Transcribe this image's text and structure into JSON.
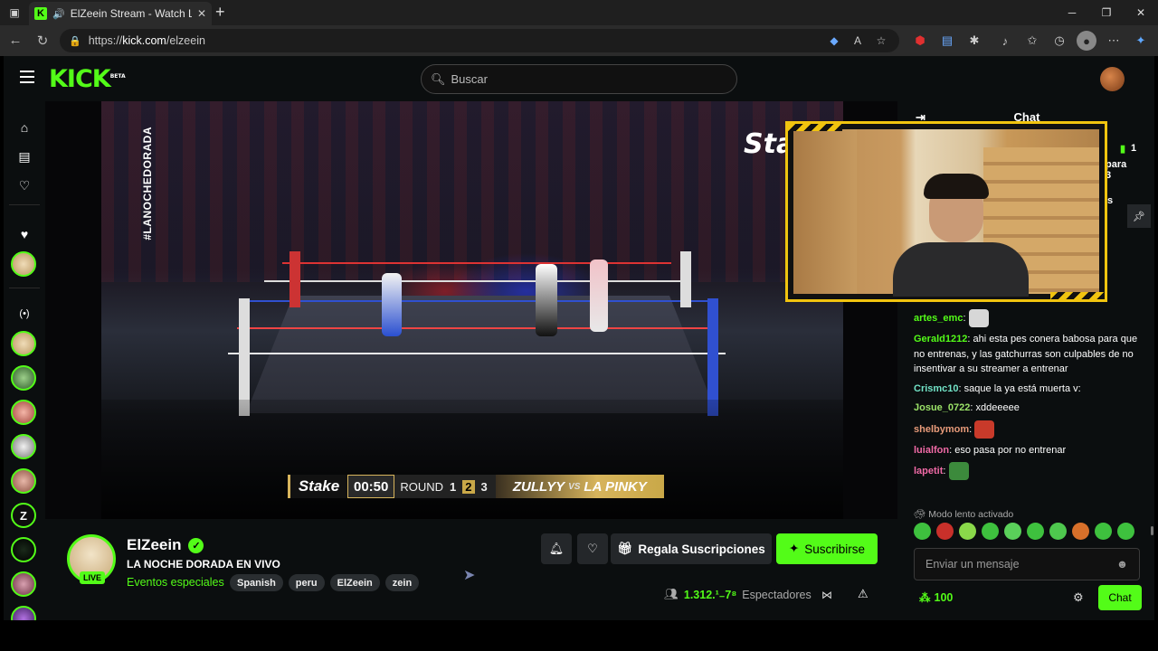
{
  "browser": {
    "tab_title": "ElZeein Stream - Watch Live",
    "url_prefix": "https://",
    "url_host": "kick.com",
    "url_path": "/elzeein"
  },
  "site": {
    "logo": "KICK",
    "logo_badge": "BETA",
    "search_placeholder": "Buscar"
  },
  "video": {
    "vertical_tag": "#LANOCHEDORADA",
    "overlay_logo": "Stake",
    "scorebar": {
      "brand": "Stake",
      "time": "00:50",
      "round_label": "ROUND",
      "rounds": [
        "1",
        "2",
        "3"
      ],
      "current_round": "2",
      "fighter_1": "ZULLYY",
      "vs": "VS",
      "fighter_2": "LA PINKY"
    }
  },
  "channel": {
    "name": "ElZeein",
    "live_badge": "LIVE",
    "stream_title": "LA NOCHE DORADA EN VIVO",
    "category": "Eventos especiales",
    "tags": [
      "Spanish",
      "peru",
      "ElZeein",
      "zein"
    ],
    "gift_label": "Regala Suscripciones",
    "subscribe_label": "Suscribirse",
    "viewer_count": "1.312.",
    "viewer_count_glitch": "¹₋7⁸",
    "viewers_label": "Espectadores"
  },
  "chat": {
    "header": "Chat",
    "peek_count": "1",
    "peek_text_1": "para",
    "peek_text_2": "3",
    "peek_text_3": "s",
    "messages": [
      {
        "user": "artes_emc",
        "text": "",
        "emote": true,
        "color": "#53fc18"
      },
      {
        "user": "Gerald1212",
        "text": "ahi esta pes conera babosa para que no entrenas, y las gatchurras son culpables de no insentivar a su streamer a entrenar",
        "emote": false,
        "color": "#53fc18"
      },
      {
        "user": "Crismc10",
        "text": "saque la ya está muerta v:",
        "emote": false,
        "color": "#72e3c7"
      },
      {
        "user": "Josue_0722",
        "text": "xddeeeee",
        "emote": false,
        "color": "#9be368"
      },
      {
        "user": "shelbymom",
        "text": "",
        "emote": true,
        "color": "#e89b7a"
      },
      {
        "user": "luialfon",
        "text": "eso pasa por no entrenar",
        "emote": false,
        "color": "#f06aa6"
      },
      {
        "user": "lapetit",
        "text": "",
        "emote": true,
        "color": "#f06aa6"
      }
    ],
    "slow_mode": "Modo lento activado",
    "input_placeholder": "Enviar un mensaje",
    "points": "100",
    "send_label": "Chat"
  },
  "colors": {
    "brand_green": "#53fc18",
    "background": "#0b0e0f",
    "gold": "#d7b45c"
  }
}
